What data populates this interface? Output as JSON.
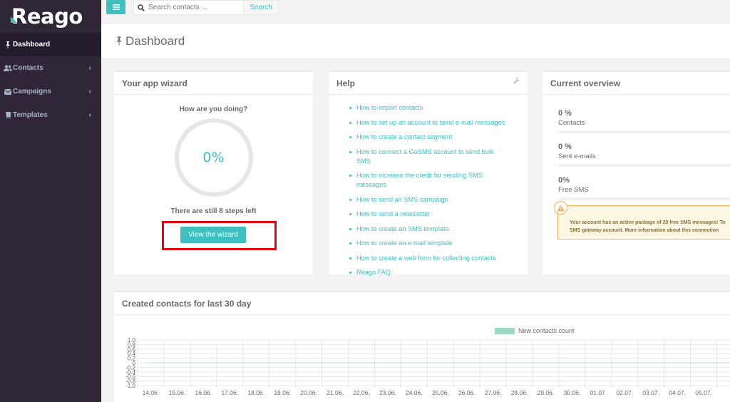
{
  "app": {
    "logo": "Reago"
  },
  "sidebar": {
    "items": [
      {
        "label": "Dashboard",
        "icon": "pin-icon"
      },
      {
        "label": "Contacts",
        "icon": "users-icon"
      },
      {
        "label": "Campaigns",
        "icon": "envelope-icon"
      },
      {
        "label": "Templates",
        "icon": "book-icon"
      }
    ]
  },
  "topbar": {
    "search_placeholder": "Search contacts ...",
    "search_button": "Search"
  },
  "page": {
    "title": "Dashboard"
  },
  "wizard": {
    "title": "Your app wizard",
    "question": "How are you doing?",
    "percent": "0%",
    "progress": 0,
    "steps_left": "There are still 8 steps left",
    "button": "View the wizard"
  },
  "help": {
    "title": "Help",
    "links": [
      "How to import contacts",
      "How to set up an account to send e-mail messages",
      "How to create a contact segment",
      "How to connect a GoSMS account to send bulk SMS",
      "How to increase the credit for sending SMS messages",
      "How to send an SMS campaign",
      "How to send a newsletter",
      "How to create an SMS template",
      "How to create an e-mail template",
      "How to create a web form for collecting contacts",
      "Reago FAQ"
    ]
  },
  "overview": {
    "title": "Current overview",
    "items": [
      {
        "value": "0 %",
        "label": "Contacts"
      },
      {
        "value": "0 %",
        "label": "Sent e-mails"
      },
      {
        "value": "0%",
        "label": "Free SMS"
      }
    ],
    "alert_line1": "Your account has an active package of 20 free SMS messages! To",
    "alert_line2": "SMS gateway account. More information about this connection"
  },
  "chart": {
    "title": "Created contacts for last 30 day",
    "legend": "New contacts count",
    "series_color": "#9ed7c8"
  },
  "chart_data": {
    "type": "line",
    "title": "Created contacts for last 30 day",
    "series": [
      {
        "name": "New contacts count",
        "values": [
          0,
          0,
          0,
          0,
          0,
          0,
          0,
          0,
          0,
          0,
          0,
          0,
          0,
          0,
          0,
          0,
          0,
          0,
          0,
          0,
          0,
          0,
          0
        ]
      }
    ],
    "x": [
      "14.06.",
      "15.06.",
      "16.06.",
      "17.06.",
      "18.06.",
      "19.06.",
      "20.06.",
      "21.06.",
      "22.06.",
      "23.06.",
      "24.06.",
      "25.06.",
      "26.06.",
      "27.06.",
      "28.06.",
      "29.06.",
      "30.06.",
      "01.07.",
      "02.07.",
      "03.07.",
      "04.07.",
      "05.07.",
      ""
    ],
    "y_ticks": [
      "1.0",
      "0.8",
      "0.6",
      "0.4",
      "0.2",
      "0",
      "-0.2",
      "-0.4",
      "-0.6",
      "-0.8",
      "-1.0"
    ],
    "ylim": [
      -1,
      1
    ],
    "grid": true,
    "legend_position": "top"
  }
}
